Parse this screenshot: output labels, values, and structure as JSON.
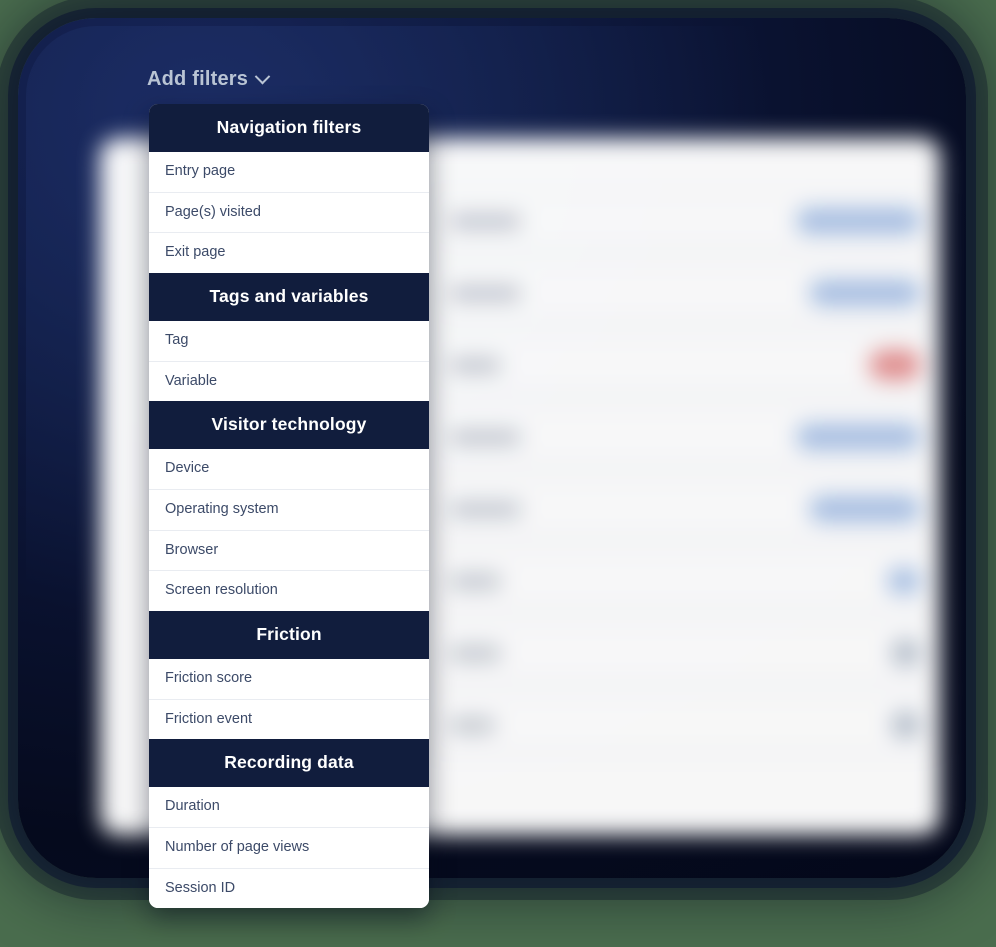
{
  "theme": {
    "page_background": "#4a6d4e",
    "panel_navy": "#0b1433",
    "menu_header_navy": "#111d3d",
    "menu_item_text": "#3c4a68",
    "trigger_text": "#b9c4d4",
    "badge_blue": "#aac3e8",
    "badge_red": "#e79191"
  },
  "trigger": {
    "label": "Add filters",
    "chevron_icon": "chevron-down-icon"
  },
  "menu": {
    "groups": [
      {
        "title": "Navigation filters",
        "items": [
          "Entry page",
          "Page(s) visited",
          "Exit page"
        ]
      },
      {
        "title": "Tags and variables",
        "items": [
          "Tag",
          "Variable"
        ]
      },
      {
        "title": "Visitor technology",
        "items": [
          "Device",
          "Operating system",
          "Browser",
          "Screen resolution"
        ]
      },
      {
        "title": "Friction",
        "items": [
          "Friction score",
          "Friction event"
        ]
      },
      {
        "title": "Recording data",
        "items": [
          "Duration",
          "Number of page views",
          "Session ID"
        ]
      }
    ]
  },
  "background_list": {
    "rows": [
      {
        "label_size": "normal",
        "badge": "wide"
      },
      {
        "label_size": "normal",
        "badge": "medium"
      },
      {
        "label_size": "short",
        "badge": "red"
      },
      {
        "label_size": "normal",
        "badge": "wide"
      },
      {
        "label_size": "normal",
        "badge": "medium"
      },
      {
        "label_size": "short",
        "badge": "small"
      },
      {
        "label_size": "short",
        "badge": "dot"
      },
      {
        "label_size": "tiny",
        "badge": "dot"
      }
    ]
  }
}
